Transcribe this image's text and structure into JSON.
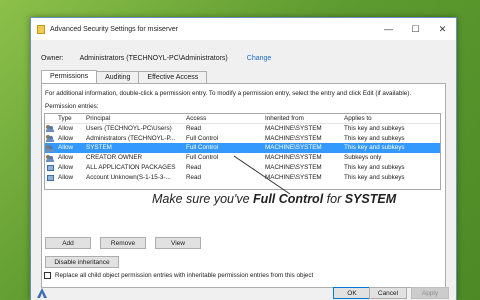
{
  "window": {
    "title": "Advanced Security Settings for msiserver",
    "controls": {
      "minimize": "—",
      "maximize": "☐",
      "close": "✕"
    }
  },
  "owner": {
    "label": "Owner:",
    "value": "Administrators (TECHNOYL-PC\\Administrators)",
    "change_link": "Change"
  },
  "tabs": [
    {
      "label": "Permissions",
      "active": true
    },
    {
      "label": "Auditing",
      "active": false
    },
    {
      "label": "Effective Access",
      "active": false
    }
  ],
  "permissions": {
    "info_text": "For additional information, double-click a permission entry. To modify a permission entry, select the entry and click Edit (if available).",
    "entries_label": "Permission entries:",
    "columns": [
      "Type",
      "Principal",
      "Access",
      "Inherited from",
      "Applies to"
    ],
    "rows": [
      {
        "icon": "users-icon",
        "type": "Allow",
        "principal": "Users (TECHNOYL-PC\\Users)",
        "access": "Read",
        "inherited": "MACHINE\\SYSTEM",
        "applies": "This key and subkeys",
        "selected": false
      },
      {
        "icon": "users-icon",
        "type": "Allow",
        "principal": "Administrators (TECHNOYL-P...",
        "access": "Full Control",
        "inherited": "MACHINE\\SYSTEM",
        "applies": "This key and subkeys",
        "selected": false
      },
      {
        "icon": "users-icon",
        "type": "Allow",
        "principal": "SYSTEM",
        "access": "Full Control",
        "inherited": "MACHINE\\SYSTEM",
        "applies": "This key and subkeys",
        "selected": true
      },
      {
        "icon": "users-icon",
        "type": "Allow",
        "principal": "CREATOR OWNER",
        "access": "Full Control",
        "inherited": "MACHINE\\SYSTEM",
        "applies": "Subkeys only",
        "selected": false
      },
      {
        "icon": "package-icon",
        "type": "Allow",
        "principal": "ALL APPLICATION PACKAGES",
        "access": "Read",
        "inherited": "MACHINE\\SYSTEM",
        "applies": "This key and subkeys",
        "selected": false
      },
      {
        "icon": "package-icon",
        "type": "Allow",
        "principal": "Account Unknown(S-1-15-3-...",
        "access": "Read",
        "inherited": "MACHINE\\SYSTEM",
        "applies": "This key and subkeys",
        "selected": false
      }
    ],
    "buttons": {
      "add": "Add",
      "remove": "Remove",
      "view": "View",
      "disable_inheritance": "Disable inheritance"
    },
    "replace_checkbox_label": "Replace all child object permission entries with inheritable permission entries from this object"
  },
  "annotation": {
    "prefix": "Make sure you've ",
    "bold": "Full Control",
    "middle": " for ",
    "bold2": "SYSTEM"
  },
  "footer": {
    "ok": "OK",
    "cancel": "Cancel",
    "apply": "Apply"
  },
  "colors": {
    "selection": "#3399ff",
    "link": "#1b6ac9",
    "desktop": "#6aa339"
  }
}
